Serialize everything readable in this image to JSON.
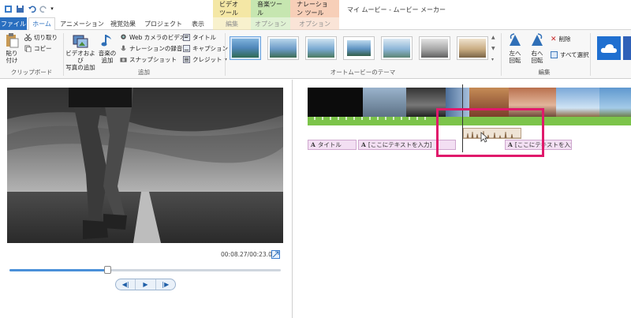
{
  "titlebar": {
    "app_title": "マイ ムービー - ムービー メーカー",
    "context_labels": [
      "ビデオ ツール",
      "音楽ツール",
      "ナレーション ツール"
    ],
    "context_colors": [
      "#f4e7a5",
      "#c6e6b0",
      "#f7cfb8"
    ]
  },
  "tabs": {
    "file": "ファイル",
    "home": "ホーム",
    "animation": "アニメーション",
    "visual_effects": "視覚効果",
    "project": "プロジェクト",
    "view": "表示",
    "edit": "編集",
    "options1": "オプション",
    "options2": "オプション"
  },
  "ribbon": {
    "clipboard": {
      "paste": "貼り\n付け",
      "cut": "切り取り",
      "copy": "コピー",
      "label": "クリップボード"
    },
    "add": {
      "add_videos_photos": "ビデオおよび\n写真の追加",
      "add_music": "音楽の\n追加",
      "webcam": "Web カメラのビデオ",
      "narration": "ナレーションの録音",
      "snapshot": "スナップショット",
      "title": "タイトル",
      "caption": "キャプション",
      "credits": "クレジット",
      "label": "追加"
    },
    "themes": {
      "label": "オートムービーのテーマ"
    },
    "edit": {
      "rotate_left": "左へ\n回転",
      "rotate_right": "右へ\n回転",
      "delete": "削除",
      "select_all": "すべて選択",
      "label": "編集"
    }
  },
  "preview": {
    "timecode": "00:08.27/00:23.00",
    "progress": 0.36
  },
  "storyboard": {
    "captions": [
      "タイトル",
      "[ここにテキストを入力]",
      "[ここにテキストを入力]"
    ]
  },
  "colors": {
    "file_tab": "#2a6fc0",
    "highlight": "#e0196b",
    "green_bar": "#7cc44a",
    "caption_bg": "#f3dff3"
  }
}
